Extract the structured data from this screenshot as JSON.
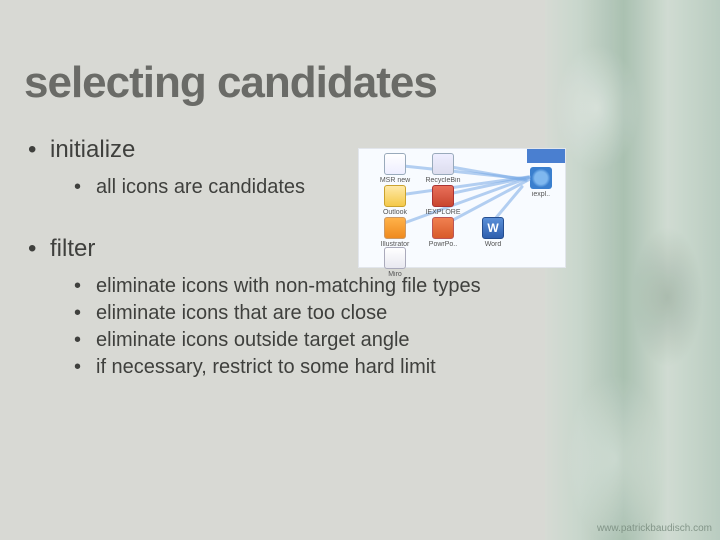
{
  "title": "selecting candidates",
  "bullets": {
    "initialize": {
      "label": "initialize",
      "sub": [
        "all icons are candidates"
      ]
    },
    "filter": {
      "label": "filter",
      "sub": [
        "eliminate icons with non-matching file types",
        "eliminate icons that are too close",
        "eliminate icons outside target angle",
        "if necessary, restrict to some hard limit"
      ]
    }
  },
  "diagram": {
    "icons": [
      {
        "name": "MSR new",
        "kind": "paper"
      },
      {
        "name": "RecycleBin",
        "kind": "bin"
      },
      {
        "name": "Outlook",
        "kind": "ol"
      },
      {
        "name": "IEXPLORE",
        "kind": "ex"
      },
      {
        "name": "Illustrator",
        "kind": "ai"
      },
      {
        "name": "PowrPo..",
        "kind": "pp"
      },
      {
        "name": "Word",
        "kind": "wd"
      },
      {
        "name": "Miro",
        "kind": "gen"
      }
    ],
    "target_icon": "ie",
    "target_label": "iexpl.."
  },
  "footer": "www.patrickbaudisch.com"
}
